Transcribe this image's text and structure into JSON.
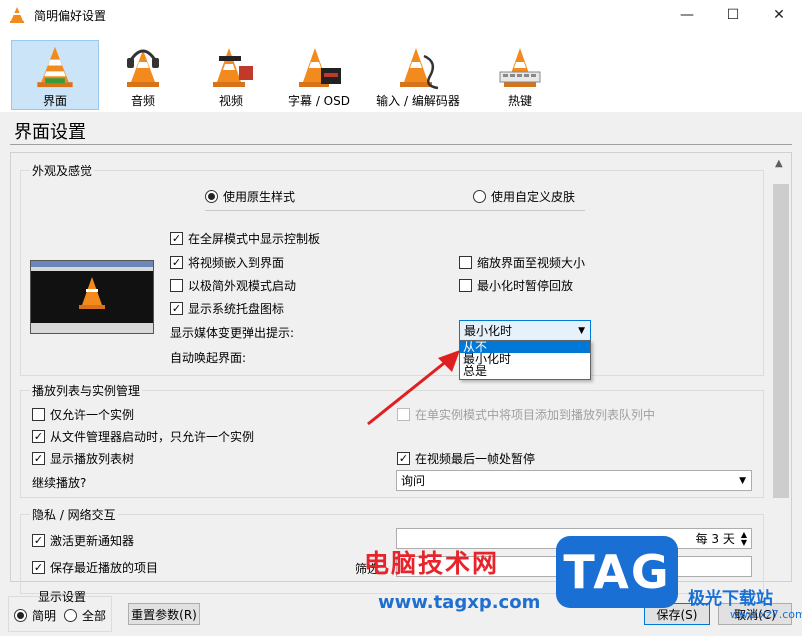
{
  "window": {
    "title": "简明偏好设置",
    "controls": {
      "minimize": "—",
      "maximize": "☐",
      "close": "✕"
    }
  },
  "toolbar": {
    "items": [
      {
        "label": "界面",
        "icon": "interface-cone-icon",
        "selected": true
      },
      {
        "label": "音频",
        "icon": "audio-headphones-cone-icon"
      },
      {
        "label": "视频",
        "icon": "video-glasses-cone-icon"
      },
      {
        "label": "字幕 / OSD",
        "icon": "subtitles-cone-icon"
      },
      {
        "label": "输入 / 编解码器",
        "icon": "codec-cable-cone-icon"
      },
      {
        "label": "热键",
        "icon": "hotkeys-cone-icon"
      }
    ]
  },
  "page": {
    "heading": "界面设置"
  },
  "appearance": {
    "title": "外观及感觉",
    "radio_native": "使用原生样式",
    "radio_custom": "使用自定义皮肤",
    "cb_fullscreen_controls": "在全屏模式中显示控制板",
    "cb_embed_video": "将视频嵌入到界面",
    "cb_resize_to_video": "缩放界面至视频大小",
    "cb_minimal_start": "以极简外观模式启动",
    "cb_pause_minimized": "最小化时暂停回放",
    "cb_tray_icon": "显示系统托盘图标",
    "popup_label": "显示媒体变更弹出提示:",
    "popup_value": "最小化时",
    "raise_label": "自动唤起界面:",
    "popup_options": [
      "从不",
      "最小化时",
      "总是"
    ]
  },
  "playlist": {
    "title": "播放列表与实例管理",
    "cb_one_instance": "仅允许一个实例",
    "cb_enqueue": "在单实例模式中将项目添加到播放列表队列中",
    "cb_one_instance_fm": "从文件管理器启动时，只允许一个实例",
    "cb_show_tree": "显示播放列表树",
    "cb_pause_last_frame": "在视频最后一帧处暂停",
    "resume_label": "继续播放?",
    "resume_value": "询问"
  },
  "privacy": {
    "title": "隐私 / 网络交互",
    "cb_update_notify": "激活更新通知器",
    "update_interval": "每 3 天",
    "cb_save_recent": "保存最近播放的项目",
    "filter_label": "筛选"
  },
  "bottom": {
    "display_label": "显示设置",
    "radio_simple": "简明",
    "radio_all": "全部",
    "reset_button": "重置参数(R)",
    "save_button": "保存(S)",
    "cancel_button": "取消(C)"
  },
  "watermark": {
    "site_name": "电脑技术网",
    "site_url": "www.tagxp.com",
    "tag": "TAG",
    "brand": "极光下载站",
    "brand_url": "www.xz7.com"
  },
  "colors": {
    "accent": "#0078d7",
    "selection": "#cce4f7",
    "cone_orange": "#f28a1e",
    "annotation_arrow": "#e02020"
  }
}
